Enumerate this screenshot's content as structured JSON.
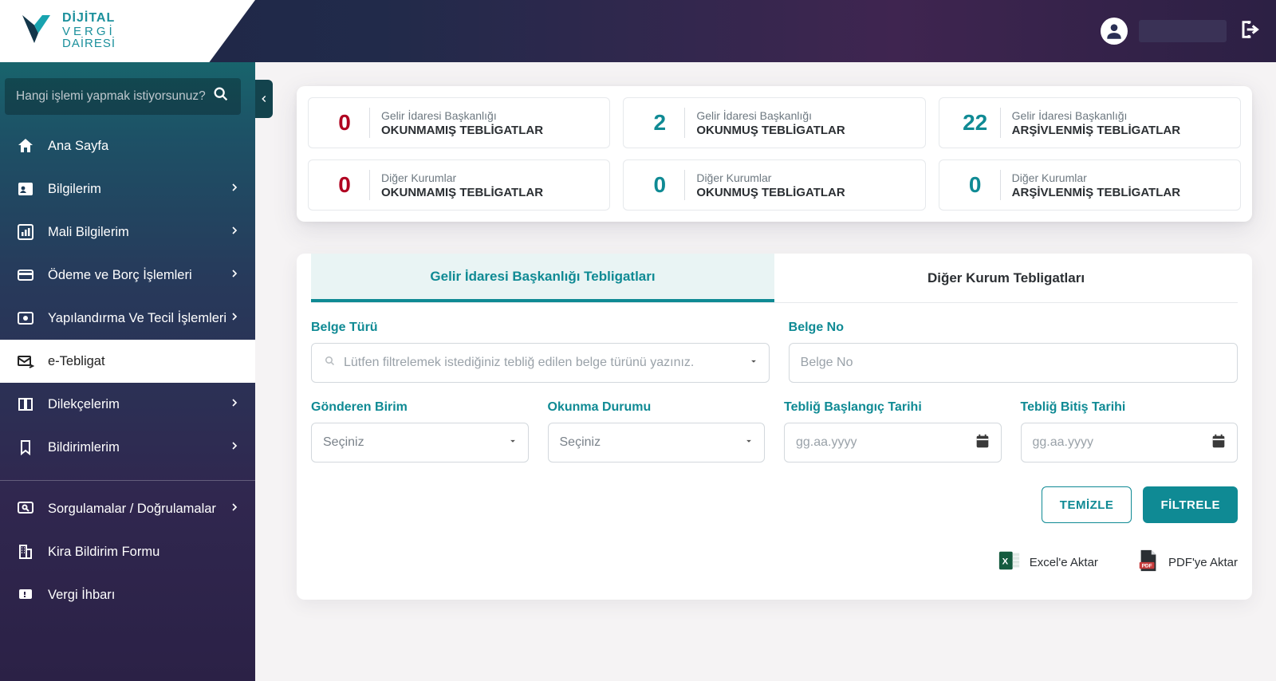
{
  "brand": {
    "line1": "DİJİTAL",
    "line2": "VERGİ",
    "line3": "DAİRESİ"
  },
  "search": {
    "placeholder": "Hangi işlemi yapmak istiyorsunuz?"
  },
  "sidebar": {
    "items": [
      {
        "label": "Ana Sayfa",
        "expandable": false
      },
      {
        "label": "Bilgilerim",
        "expandable": true
      },
      {
        "label": "Mali Bilgilerim",
        "expandable": true
      },
      {
        "label": "Ödeme ve Borç İşlemleri",
        "expandable": true
      },
      {
        "label": "Yapılandırma Ve Tecil İşlemleri",
        "expandable": true
      },
      {
        "label": "e-Tebligat",
        "expandable": false,
        "active": true
      },
      {
        "label": "Dilekçelerim",
        "expandable": true
      },
      {
        "label": "Bildirimlerim",
        "expandable": true
      },
      {
        "label": "Sorgulamalar / Doğrulamalar",
        "expandable": true
      },
      {
        "label": "Kira Bildirim Formu",
        "expandable": false
      },
      {
        "label": "Vergi İhbarı",
        "expandable": false
      }
    ]
  },
  "stats": {
    "row1": [
      {
        "num": "0",
        "numClass": "num-red",
        "sub": "Gelir İdaresi Başkanlığı",
        "title": "OKUNMAMIŞ TEBLİGATLAR"
      },
      {
        "num": "2",
        "numClass": "num-teal",
        "sub": "Gelir İdaresi Başkanlığı",
        "title": "OKUNMUŞ TEBLİGATLAR"
      },
      {
        "num": "22",
        "numClass": "num-teal",
        "sub": "Gelir İdaresi Başkanlığı",
        "title": "ARŞİVLENMİŞ TEBLİGATLAR"
      }
    ],
    "row2": [
      {
        "num": "0",
        "numClass": "num-red",
        "sub": "Diğer Kurumlar",
        "title": "OKUNMAMIŞ TEBLİGATLAR"
      },
      {
        "num": "0",
        "numClass": "num-teal",
        "sub": "Diğer Kurumlar",
        "title": "OKUNMUŞ TEBLİGATLAR"
      },
      {
        "num": "0",
        "numClass": "num-teal",
        "sub": "Diğer Kurumlar",
        "title": "ARŞİVLENMİŞ TEBLİGATLAR"
      }
    ]
  },
  "tabs": {
    "active": "Gelir İdaresi Başkanlığı Tebligatları",
    "other": "Diğer Kurum Tebligatları"
  },
  "form": {
    "belgeTuru": {
      "label": "Belge Türü",
      "placeholder": "Lütfen filtrelemek istediğiniz tebliğ edilen belge türünü yazınız."
    },
    "belgeNo": {
      "label": "Belge No",
      "placeholder": "Belge No"
    },
    "gonderen": {
      "label": "Gönderen Birim",
      "placeholder": "Seçiniz"
    },
    "okunma": {
      "label": "Okunma Durumu",
      "placeholder": "Seçiniz"
    },
    "baslangic": {
      "label": "Tebliğ Başlangıç Tarihi",
      "placeholder": "gg.aa.yyyy"
    },
    "bitis": {
      "label": "Tebliğ Bitiş Tarihi",
      "placeholder": "gg.aa.yyyy"
    }
  },
  "buttons": {
    "clear": "TEMİZLE",
    "filter": "FİLTRELE"
  },
  "export": {
    "excel": "Excel'e Aktar",
    "pdf": "PDF'ye Aktar"
  }
}
